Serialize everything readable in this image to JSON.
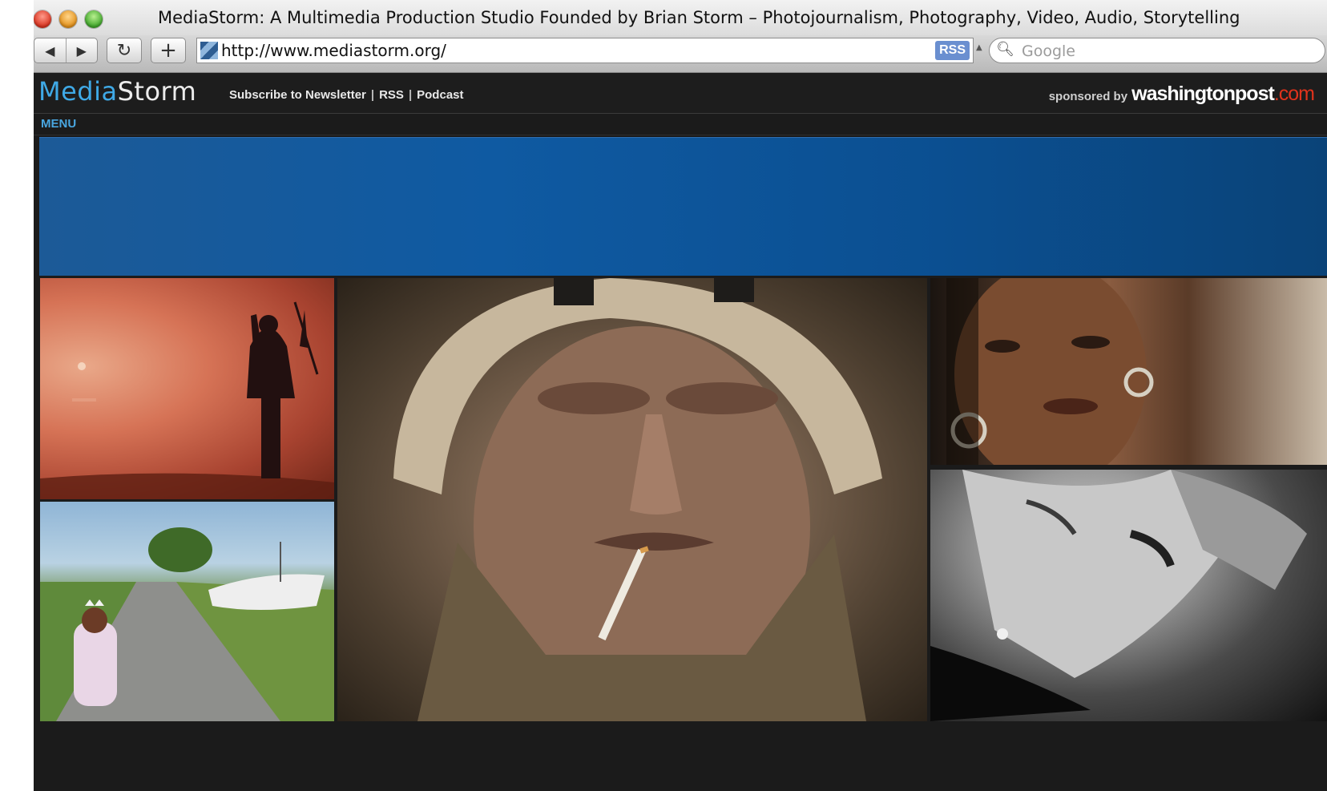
{
  "window": {
    "title": "MediaStorm: A Multimedia Production Studio Founded by Brian Storm – Photojournalism, Photography, Video, Audio, Storytelling"
  },
  "toolbar": {
    "back_glyph": "◀",
    "forward_glyph": "▶",
    "reload_glyph": "↻",
    "add_glyph": "+",
    "url": "http://www.mediastorm.org/",
    "rss_label": "RSS",
    "search_glyph": "🔍︎",
    "search_placeholder": "Google"
  },
  "site": {
    "logo_part1": "Media",
    "logo_part2": "Storm",
    "links": [
      "Subscribe to Newsletter",
      "RSS",
      "Podcast"
    ],
    "link_separator": "|",
    "sponsor_label": "sponsored by",
    "sponsor_name": "washingtonpost",
    "sponsor_tld": ".com",
    "menu_label": "MENU"
  },
  "tiles": [
    {
      "name": "photo-sunset-silhouette",
      "icon": "photo"
    },
    {
      "name": "photo-girl-on-road",
      "icon": "photo"
    },
    {
      "name": "photo-marine-portrait",
      "icon": "photo"
    },
    {
      "name": "photo-woman-portrait",
      "icon": "photo"
    },
    {
      "name": "photo-black-and-white-portrait",
      "icon": "photo"
    }
  ],
  "colors": {
    "logo_accent": "#3fa9e6",
    "menu_accent": "#49a6e0",
    "banner": "#0f5aa2",
    "sponsor_tld": "#e0331c"
  }
}
